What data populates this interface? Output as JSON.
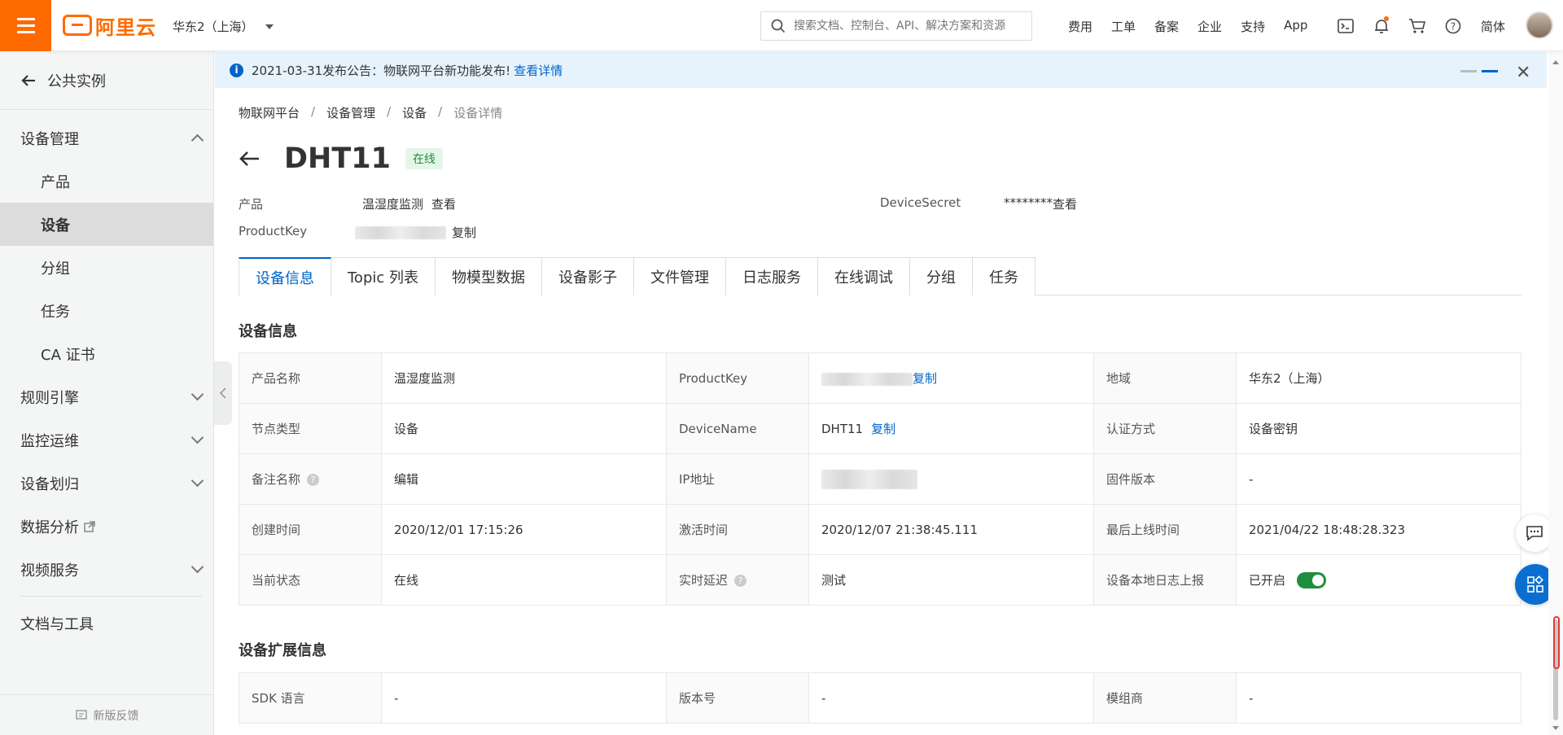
{
  "topbar": {
    "logo_text": "阿里云",
    "region": "华东2（上海）",
    "search_placeholder": "搜索文档、控制台、API、解决方案和资源",
    "nav": [
      "费用",
      "工单",
      "备案",
      "企业",
      "支持",
      "App"
    ],
    "lang": "简体",
    "brand_color": "#ff6a00"
  },
  "sidebar": {
    "back_label": "公共实例",
    "group_device": "设备管理",
    "items": [
      "产品",
      "设备",
      "分组",
      "任务",
      "CA 证书"
    ],
    "groups": [
      "规则引擎",
      "监控运维",
      "设备划归",
      "数据分析",
      "视频服务"
    ],
    "docs": "文档与工具",
    "feedback": "新版反馈"
  },
  "notice": {
    "text": "2021-03-31发布公告：物联网平台新功能发布!",
    "link": "查看详情"
  },
  "breadcrumb": [
    "物联网平台",
    "设备管理",
    "设备",
    "设备详情"
  ],
  "device": {
    "name": "DHT11",
    "status": "在线",
    "product_label": "产品",
    "product_value": "温湿度监测",
    "view": "查看",
    "productkey_label": "ProductKey",
    "copy": "复制",
    "secret_label": "DeviceSecret",
    "secret_value": "********"
  },
  "tabs": [
    "设备信息",
    "Topic 列表",
    "物模型数据",
    "设备影子",
    "文件管理",
    "日志服务",
    "在线调试",
    "分组",
    "任务"
  ],
  "info_title": "设备信息",
  "info": {
    "r1": {
      "k1": "产品名称",
      "v1": "温湿度监测",
      "k2": "ProductKey",
      "k3": "地域",
      "v3": "华东2（上海）"
    },
    "r2": {
      "k1": "节点类型",
      "v1": "设备",
      "k2": "DeviceName",
      "v2": "DHT11",
      "k3": "认证方式",
      "v3": "设备密钥"
    },
    "r3": {
      "k1": "备注名称",
      "v1": "编辑",
      "k2": "IP地址",
      "k3": "固件版本",
      "v3": "-"
    },
    "r4": {
      "k1": "创建时间",
      "v1": "2020/12/01 17:15:26",
      "k2": "激活时间",
      "v2": "2020/12/07 21:38:45.111",
      "k3": "最后上线时间",
      "v3": "2021/04/22 18:48:28.323"
    },
    "r5": {
      "k1": "当前状态",
      "v1": "在线",
      "k2": "实时延迟",
      "v2": "测试",
      "k3": "设备本地日志上报",
      "v3": "已开启"
    }
  },
  "ext_title": "设备扩展信息",
  "ext": {
    "k1": "SDK 语言",
    "v1": "-",
    "k2": "版本号",
    "v2": "-",
    "k3": "模组商",
    "v3": "-"
  }
}
